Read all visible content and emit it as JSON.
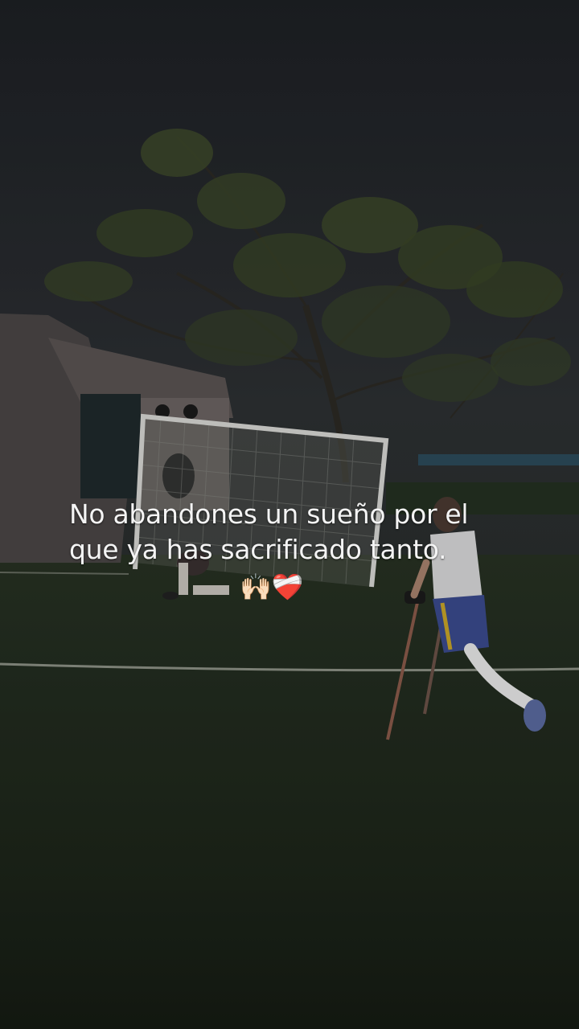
{
  "caption": {
    "line1": "No abandones un sueño por el",
    "line2": "que ya has sacrificado tanto.",
    "emoji1": "🙌🏻",
    "emoji2": "❤️‍🩹"
  },
  "scene": {
    "description_icons": [
      "soccer-goal-icon",
      "tree-icon",
      "player-on-crutches-icon"
    ],
    "colors": {
      "sky": "#26292d",
      "grass": "#222c1f",
      "text": "#f4f4f4"
    }
  }
}
